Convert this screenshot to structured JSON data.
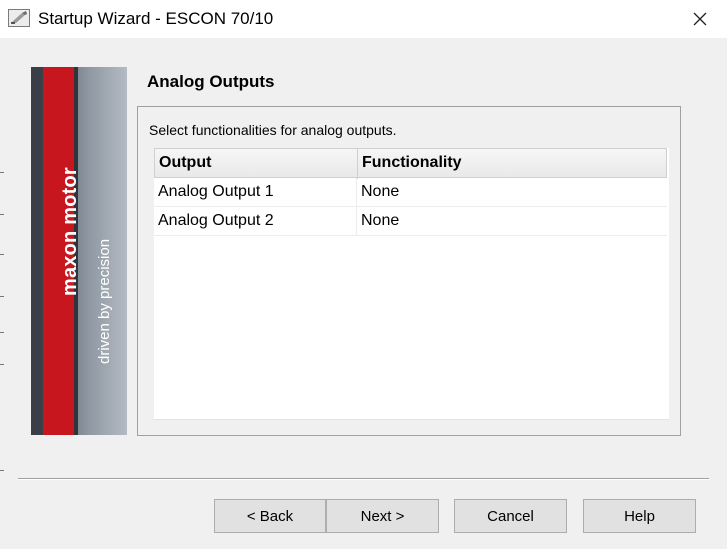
{
  "window": {
    "title": "Startup Wizard - ESCON 70/10",
    "app_icon": "wizard-app-icon",
    "close_icon": "close-icon"
  },
  "banner": {
    "brand": "maxon motor",
    "tagline": "driven by precision"
  },
  "page": {
    "heading": "Analog Outputs",
    "instruction": "Select functionalities for analog outputs."
  },
  "table": {
    "columns": [
      "Output",
      "Functionality"
    ],
    "rows": [
      {
        "output": "Analog Output 1",
        "functionality": "None"
      },
      {
        "output": "Analog Output 2",
        "functionality": "None"
      }
    ]
  },
  "buttons": {
    "back": "< Back",
    "next": "Next >",
    "cancel": "Cancel",
    "help": "Help"
  },
  "colors": {
    "brand_red": "#c8161e",
    "window_bg": "#f0f0f0"
  }
}
